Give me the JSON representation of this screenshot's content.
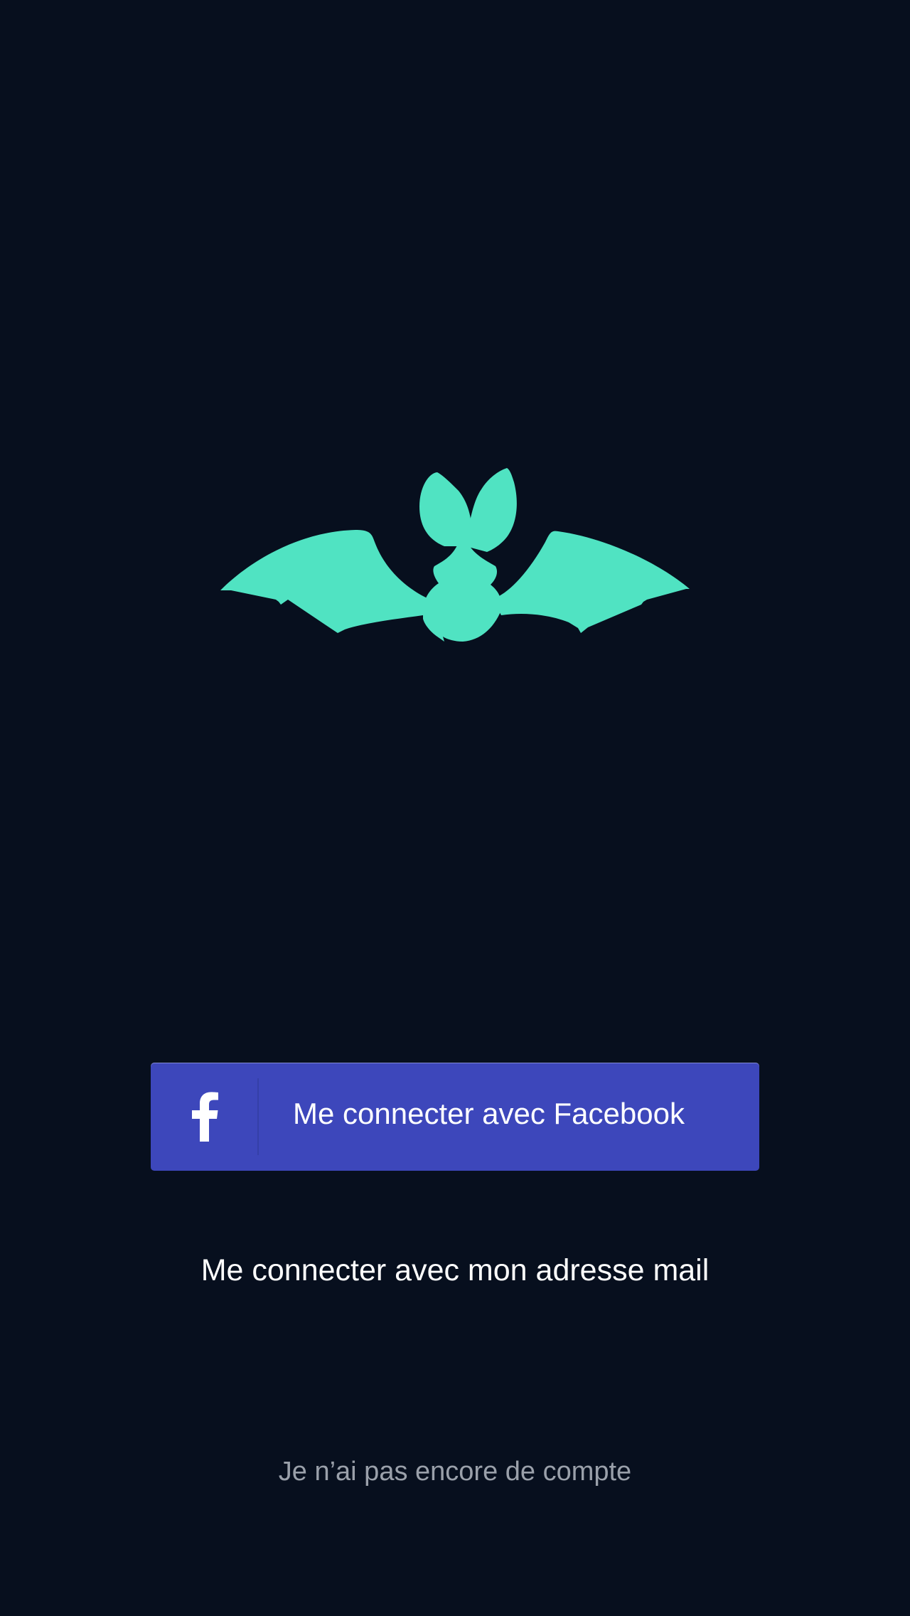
{
  "brand": {
    "logo_icon": "bat-icon",
    "logo_color": "#50e3c2",
    "background_color": "#070f1e"
  },
  "facebook_login": {
    "icon": "facebook-icon",
    "label": "Me connecter avec Facebook",
    "color": "#3d47bb"
  },
  "email_login": {
    "label": "Me connecter avec mon adresse mail"
  },
  "signup": {
    "label": "Je n’ai pas encore de compte"
  }
}
